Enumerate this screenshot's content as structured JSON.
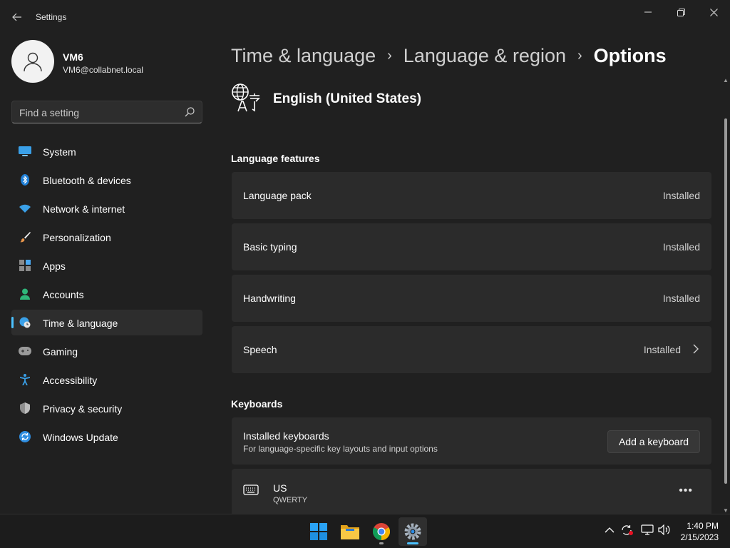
{
  "window": {
    "title": "Settings",
    "controls": [
      "minimize",
      "restore",
      "close"
    ]
  },
  "profile": {
    "name": "VM6",
    "email": "VM6@collabnet.local"
  },
  "search": {
    "placeholder": "Find a setting"
  },
  "nav": {
    "items": [
      {
        "label": "System",
        "icon": "system-icon"
      },
      {
        "label": "Bluetooth & devices",
        "icon": "bluetooth-icon"
      },
      {
        "label": "Network & internet",
        "icon": "wifi-icon"
      },
      {
        "label": "Personalization",
        "icon": "brush-icon"
      },
      {
        "label": "Apps",
        "icon": "apps-icon"
      },
      {
        "label": "Accounts",
        "icon": "person-icon"
      },
      {
        "label": "Time & language",
        "icon": "globe-clock-icon",
        "active": true
      },
      {
        "label": "Gaming",
        "icon": "gamepad-icon"
      },
      {
        "label": "Accessibility",
        "icon": "accessibility-icon"
      },
      {
        "label": "Privacy & security",
        "icon": "shield-icon"
      },
      {
        "label": "Windows Update",
        "icon": "update-icon"
      }
    ]
  },
  "breadcrumb": {
    "items": [
      "Time & language",
      "Language & region"
    ],
    "current": "Options"
  },
  "language": {
    "name": "English (United States)"
  },
  "sections": {
    "features_title": "Language features",
    "keyboards_title": "Keyboards"
  },
  "features": [
    {
      "label": "Language pack",
      "status": "Installed"
    },
    {
      "label": "Basic typing",
      "status": "Installed"
    },
    {
      "label": "Handwriting",
      "status": "Installed"
    },
    {
      "label": "Speech",
      "status": "Installed",
      "has_chevron": true
    }
  ],
  "keyboards": {
    "installed_title": "Installed keyboards",
    "installed_subtitle": "For language-specific key layouts and input options",
    "add_button": "Add a keyboard",
    "list": [
      {
        "name": "US",
        "layout": "QWERTY"
      }
    ]
  },
  "taskbar": {
    "apps": [
      "start-icon",
      "file-explorer-icon",
      "chrome-icon",
      "settings-icon"
    ],
    "active_app": "settings-icon",
    "time": "1:40 PM",
    "date": "2/15/2023"
  },
  "colors": {
    "accent": "#4cc2ff",
    "background": "#202020",
    "card": "#2b2b2b"
  }
}
